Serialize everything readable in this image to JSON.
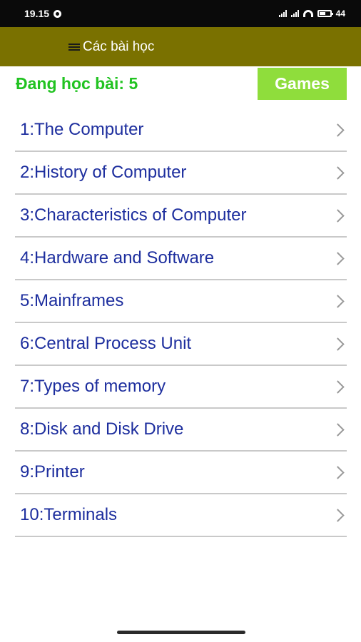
{
  "status_bar": {
    "time": "19.15",
    "battery": "44"
  },
  "app_bar": {
    "title": "Các bài học"
  },
  "progress": {
    "label": "Đang học bài: 5"
  },
  "games_button": {
    "label": "Games"
  },
  "lessons": [
    {
      "label": "1:The Computer"
    },
    {
      "label": "2:History of Computer"
    },
    {
      "label": "3:Characteristics of Computer"
    },
    {
      "label": "4:Hardware and Software"
    },
    {
      "label": "5:Mainframes"
    },
    {
      "label": "6:Central Process Unit"
    },
    {
      "label": "7:Types of memory"
    },
    {
      "label": "8:Disk and Disk Drive"
    },
    {
      "label": "9:Printer"
    },
    {
      "label": "10:Terminals"
    }
  ],
  "colors": {
    "app_bar": "#7a7100",
    "progress_text": "#21c321",
    "games_button": "#8fdd3c",
    "lesson_text": "#1d2e9e"
  }
}
